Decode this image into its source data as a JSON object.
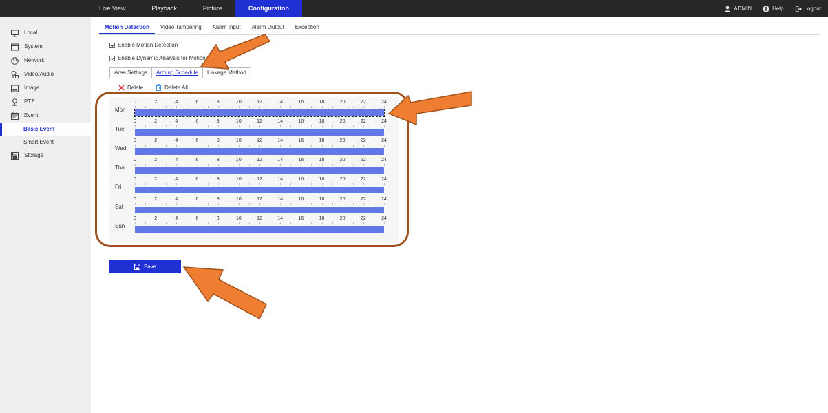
{
  "topnav": {
    "items": [
      {
        "label": "Live View",
        "active": false
      },
      {
        "label": "Playback",
        "active": false
      },
      {
        "label": "Picture",
        "active": false
      },
      {
        "label": "Configuration",
        "active": true
      }
    ],
    "user_label": "ADMIN",
    "help_label": "Help",
    "logout_label": "Logout"
  },
  "sidebar": {
    "items": [
      {
        "label": "Local",
        "icon": "monitor-icon"
      },
      {
        "label": "System",
        "icon": "system-icon"
      },
      {
        "label": "Network",
        "icon": "network-icon"
      },
      {
        "label": "Video/Audio",
        "icon": "video-audio-icon"
      },
      {
        "label": "Image",
        "icon": "image-icon"
      },
      {
        "label": "PTZ",
        "icon": "ptz-icon"
      },
      {
        "label": "Event",
        "icon": "event-icon"
      },
      {
        "label": "Basic Event",
        "sub": true,
        "active": true
      },
      {
        "label": "Smart Event",
        "sub": true,
        "active": false
      },
      {
        "label": "Storage",
        "icon": "storage-icon"
      }
    ]
  },
  "tabs": [
    {
      "label": "Motion Detection",
      "active": true
    },
    {
      "label": "Video Tampering",
      "active": false
    },
    {
      "label": "Alarm Input",
      "active": false
    },
    {
      "label": "Alarm Output",
      "active": false
    },
    {
      "label": "Exception",
      "active": false
    }
  ],
  "checks": {
    "enable_motion": "Enable Motion Detection",
    "enable_dynamic": "Enable Dynamic Analysis for Motion"
  },
  "subtabs": [
    {
      "label": "Area Settings",
      "active": false
    },
    {
      "label": "Arming Schedule",
      "active": true
    },
    {
      "label": "Linkage Method",
      "active": false
    }
  ],
  "toolbar": {
    "delete_label": "Delete",
    "delete_all_label": "Delete All"
  },
  "schedule": {
    "ticks": [
      "0",
      "2",
      "4",
      "6",
      "8",
      "10",
      "12",
      "14",
      "16",
      "18",
      "20",
      "22",
      "24"
    ],
    "days": [
      "Mon",
      "Tue",
      "Wed",
      "Thu",
      "Fri",
      "Sat",
      "Sun"
    ],
    "ranges": [
      [
        0,
        24
      ],
      [
        0,
        24
      ],
      [
        0,
        24
      ],
      [
        0,
        24
      ],
      [
        0,
        24
      ],
      [
        0,
        24
      ],
      [
        0,
        24
      ]
    ],
    "bar_color": "#6278e6"
  },
  "save": {
    "label": "Save"
  },
  "colors": {
    "accent": "#1f31d3",
    "highlight": "#a0521d",
    "arrow": "#ef7d32"
  }
}
